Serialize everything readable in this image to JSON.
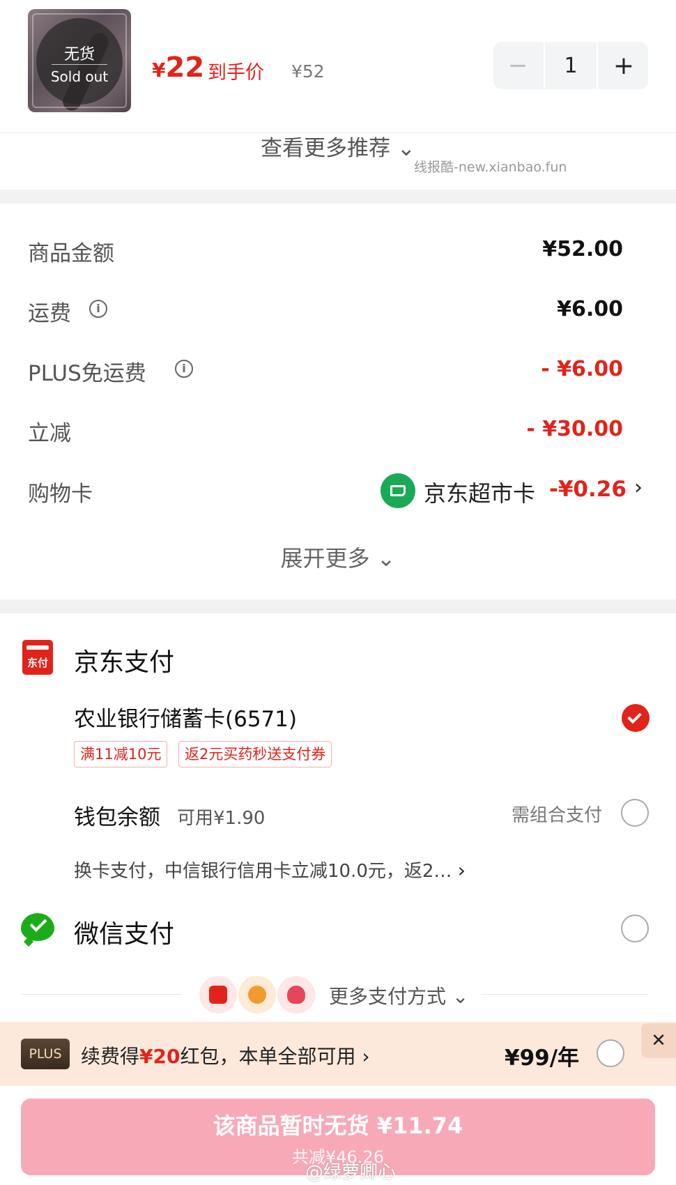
{
  "product": {
    "sold_out_cn": "无货",
    "sold_out_en": "Sold out",
    "price_currency": "¥",
    "price_value": "22",
    "price_tag": "到手价",
    "orig_price": "¥52",
    "quantity": "1",
    "minus": "−",
    "plus": "+"
  },
  "more_recommend": "查看更多推荐 ⌄",
  "watermark_top": "线报酷-new.xianbao.fun",
  "summary": {
    "rows": [
      {
        "label": "商品金额",
        "value": "¥52.00"
      },
      {
        "label": "运费",
        "value": "¥6.00"
      },
      {
        "label": "PLUS免运费",
        "value": "- ¥6.00"
      },
      {
        "label": "立减",
        "value": "- ¥30.00"
      },
      {
        "label": "购物卡",
        "value": ""
      }
    ],
    "info_glyph": "i",
    "card_name": "京东超市卡",
    "card_amount": "-¥0.26",
    "chevron": "›",
    "expand_more": "展开更多 ⌄"
  },
  "payment": {
    "jd_title": "京东支付",
    "jd_icon_text": "东付",
    "bank_card": "农业银行储蓄卡(6571)",
    "tags": [
      "满11减10元",
      "返2元买药秒送支付券"
    ],
    "wallet_label": "钱包余额",
    "wallet_available": "可用¥1.90",
    "combo_note": "需组合支付",
    "switch_card": "换卡支付，中信银行信用卡立减10.0元，返2…",
    "wechat_title": "微信支付",
    "more_methods": "更多支付方式 ⌄"
  },
  "plus_banner": {
    "badge": "PLUS",
    "text_before": "续费得",
    "highlight": "¥20",
    "text_after": "红包，本单全部可用 ›",
    "price": "¥99/年",
    "close": "✕"
  },
  "bottom": {
    "button_main": "该商品暂时无货 ¥11.74",
    "button_sub": "共减¥46.26",
    "watermark": "@绿萝卿心"
  },
  "colors": {
    "accent": "#e2231a",
    "wechat": "#1aad19",
    "jd_card": "#1aaa55",
    "button": "#f8a9b8"
  }
}
